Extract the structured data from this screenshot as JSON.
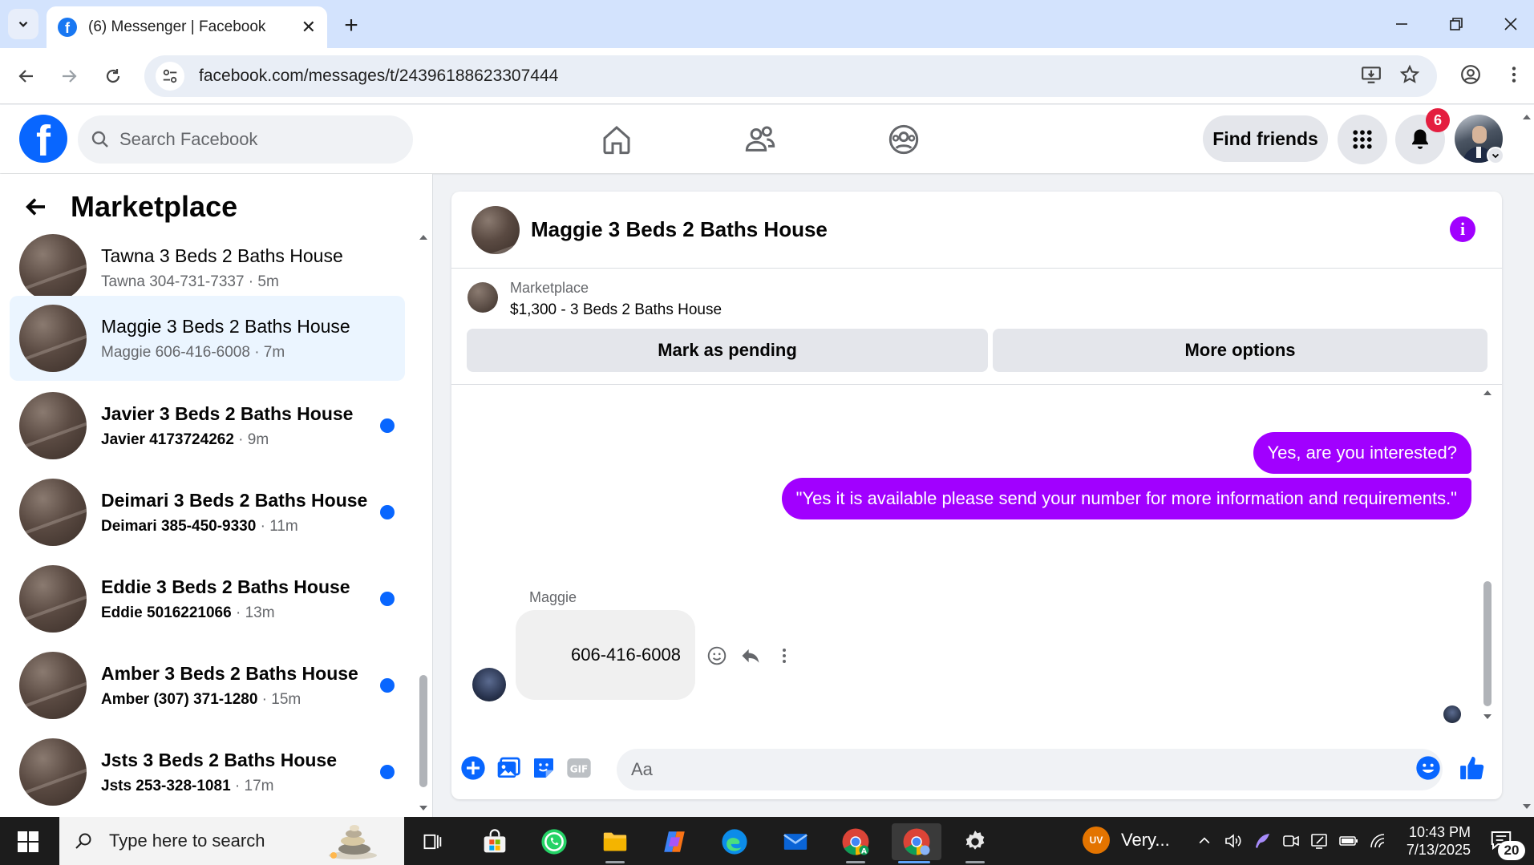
{
  "browser": {
    "tab_title": "(6) Messenger | Facebook",
    "url": "facebook.com/messages/t/24396188623307444"
  },
  "facebook": {
    "search_placeholder": "Search Facebook",
    "find_friends": "Find friends",
    "notification_count": "6",
    "brand_color": "#0866ff"
  },
  "sidebar": {
    "title": "Marketplace",
    "conversations": [
      {
        "name": "Tawna 3 Beds 2 Baths House",
        "contact": "Tawna 304-731-7337",
        "time": " · 5m",
        "unread": false
      },
      {
        "name": "Maggie 3 Beds 2 Baths House",
        "contact": "Maggie 606-416-6008",
        "time": " · 7m",
        "unread": false,
        "active": true
      },
      {
        "name": "Javier 3 Beds 2 Baths House",
        "contact": "Javier 4173724262",
        "time": " · 9m",
        "unread": true
      },
      {
        "name": "Deimari 3 Beds 2 Baths House",
        "contact": "Deimari 385-450-9330",
        "time": " · 11m",
        "unread": true
      },
      {
        "name": "Eddie 3 Beds 2 Baths House",
        "contact": "Eddie 5016221066",
        "time": " · 13m",
        "unread": true
      },
      {
        "name": "Amber 3 Beds 2 Baths House",
        "contact": "Amber (307) 371-1280",
        "time": " · 15m",
        "unread": true
      },
      {
        "name": "Jsts 3 Beds 2 Baths House",
        "contact": "Jsts 253-328-1081",
        "time": " · 17m",
        "unread": true
      }
    ]
  },
  "chat": {
    "title": "Maggie 3 Beds 2 Baths House",
    "marketplace_label": "Marketplace",
    "listing": "$1,300 - 3 Beds 2 Baths House",
    "mark_pending": "Mark as pending",
    "more_options": "More options",
    "outgoing": [
      "Yes, are you interested?",
      "\"Yes it is available please send your number for more information and requirements.\""
    ],
    "incoming_sender": "Maggie",
    "incoming_message": "606-416-6008",
    "composer_placeholder": "Aa",
    "accent_color": "#a100ff"
  },
  "taskbar": {
    "search_placeholder": "Type here to search",
    "weather_badge": "UV",
    "weather_text": "Very...",
    "time": "10:43 PM",
    "date": "7/13/2025",
    "notification_count": "20"
  }
}
